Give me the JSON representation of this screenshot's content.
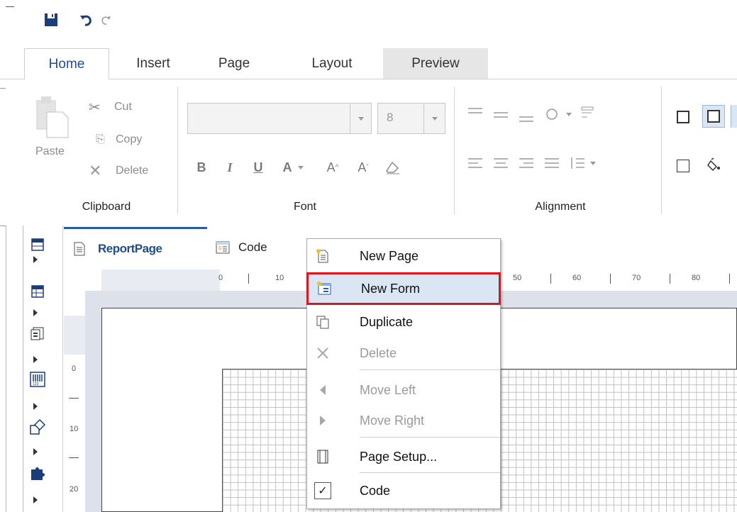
{
  "quick_access": {
    "save_icon": "save-icon",
    "undo_icon": "undo-icon",
    "redo_icon": "redo-icon"
  },
  "ribbon_tabs": [
    "Home",
    "Insert",
    "Page",
    "Layout",
    "Preview"
  ],
  "clipboard": {
    "paste": "Paste",
    "cut": "Cut",
    "copy": "Copy",
    "delete": "Delete",
    "group_label": "Clipboard"
  },
  "font": {
    "font_name": "",
    "font_size": "8",
    "bold": "B",
    "italic": "I",
    "underline": "U",
    "font_color": "A",
    "grow": "A",
    "shrink": "A",
    "group_label": "Font"
  },
  "alignment": {
    "group_label": "Alignment"
  },
  "doc_tabs": {
    "report_page": "ReportPage",
    "code": "Code"
  },
  "ruler": {
    "h_ticks": [
      "0",
      "10",
      "50",
      "60",
      "70",
      "80"
    ],
    "v_ticks": [
      "0",
      "10",
      "20"
    ]
  },
  "context_menu": {
    "items": [
      {
        "label": "New Page",
        "icon": "new-page-icon",
        "enabled": true
      },
      {
        "label": "New Form",
        "icon": "new-form-icon",
        "enabled": true,
        "highlighted": true
      },
      {
        "label": "Duplicate",
        "icon": "duplicate-icon",
        "enabled": true
      },
      {
        "label": "Delete",
        "icon": "delete-icon",
        "enabled": false
      },
      {
        "label": "Move Left",
        "icon": "move-left-icon",
        "enabled": false
      },
      {
        "label": "Move Right",
        "icon": "move-right-icon",
        "enabled": false
      },
      {
        "label": "Page Setup...",
        "icon": "page-setup-icon",
        "enabled": true
      },
      {
        "label": "Code",
        "icon": "checkmark-icon",
        "enabled": true,
        "checked": true
      }
    ]
  },
  "colors": {
    "accent": "#2a5aa8",
    "highlight": "#dbe6f4",
    "callout": "#e0121b"
  }
}
